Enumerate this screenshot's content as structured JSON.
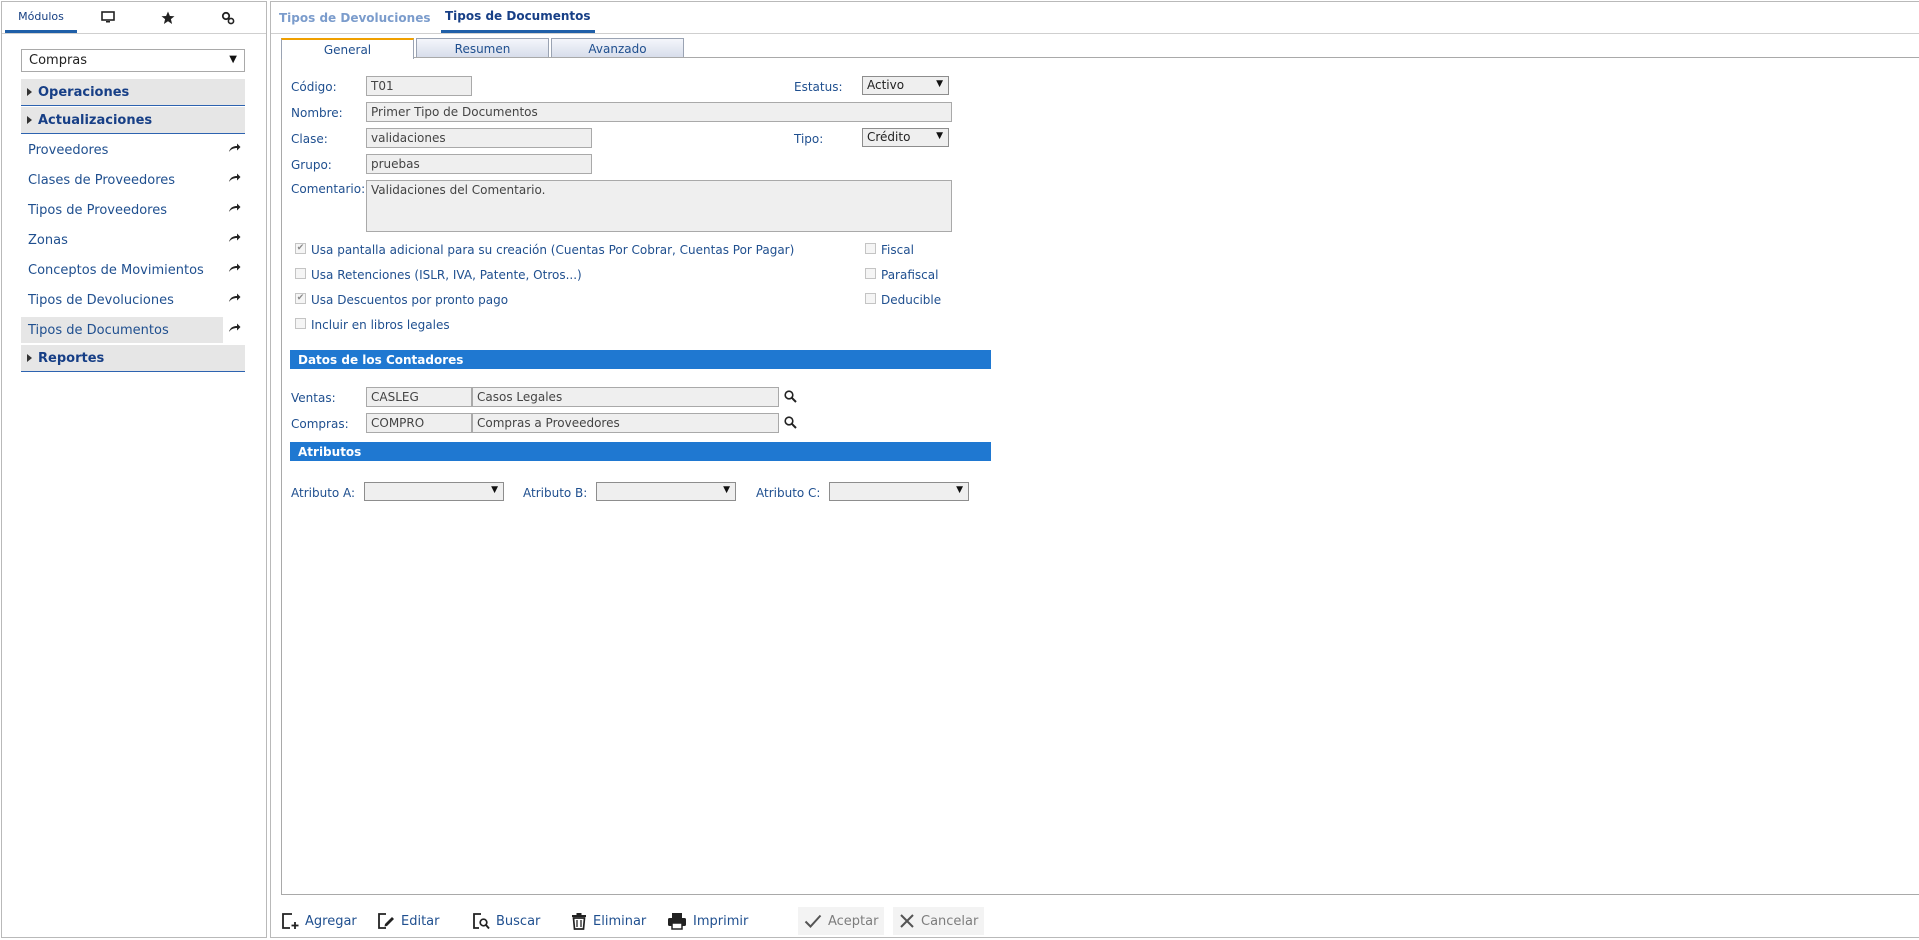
{
  "sidebar": {
    "tabs": [
      {
        "label": "Módulos",
        "icon": ""
      },
      {
        "label": "",
        "icon": "monitor-icon"
      },
      {
        "label": "",
        "icon": "star-icon"
      },
      {
        "label": "",
        "icon": "settings-icon"
      }
    ],
    "module_select": "Compras",
    "groups": {
      "operaciones": "Operaciones",
      "actualizaciones": "Actualizaciones",
      "reportes": "Reportes"
    },
    "items": [
      {
        "label": "Proveedores"
      },
      {
        "label": "Clases de Proveedores"
      },
      {
        "label": "Tipos de Proveedores"
      },
      {
        "label": "Zonas"
      },
      {
        "label": "Conceptos de Movimientos"
      },
      {
        "label": "Tipos de Devoluciones"
      },
      {
        "label": "Tipos de Documentos"
      }
    ]
  },
  "doc_tabs": [
    "Tipos de Devoluciones",
    "Tipos de Documentos"
  ],
  "sub_tabs": [
    "General",
    "Resumen",
    "Avanzado"
  ],
  "form": {
    "codigo": {
      "label": "Código:",
      "value": "T01"
    },
    "estatus": {
      "label": "Estatus:",
      "value": "Activo"
    },
    "nombre": {
      "label": "Nombre:",
      "value": "Primer Tipo de Documentos"
    },
    "clase": {
      "label": "Clase:",
      "value": "validaciones"
    },
    "tipo": {
      "label": "Tipo:",
      "value": "Crédito"
    },
    "grupo": {
      "label": "Grupo:",
      "value": "pruebas"
    },
    "comentario": {
      "label": "Comentario:",
      "value": "Validaciones del Comentario."
    }
  },
  "checks": [
    {
      "label": "Usa pantalla adicional para su creación (Cuentas Por Cobrar, Cuentas Por Pagar)",
      "checked": "✔"
    },
    {
      "label": "Usa Retenciones (ISLR, IVA, Patente, Otros...)",
      "checked": ""
    },
    {
      "label": "Usa Descuentos por pronto pago",
      "checked": "✔"
    },
    {
      "label": "Incluir en libros legales",
      "checked": ""
    },
    {
      "label": "Fiscal",
      "checked": ""
    },
    {
      "label": "Parafiscal",
      "checked": ""
    },
    {
      "label": "Deducible",
      "checked": ""
    }
  ],
  "contadores": {
    "title": "Datos de los Contadores",
    "ventas": {
      "label": "Ventas:",
      "code": "CASLEG",
      "desc": "Casos Legales"
    },
    "compras": {
      "label": "Compras:",
      "code": "COMPRO",
      "desc": "Compras a Proveedores"
    }
  },
  "atributos": {
    "title": "Atributos",
    "a": {
      "label": "Atributo A:",
      "value": ""
    },
    "b": {
      "label": "Atributo B:",
      "value": ""
    },
    "c": {
      "label": "Atributo C:",
      "value": ""
    }
  },
  "actions": {
    "agregar": "Agregar",
    "editar": "Editar",
    "buscar": "Buscar",
    "eliminar": "Eliminar",
    "imprimir": "Imprimir",
    "aceptar": "Aceptar",
    "cancelar": "Cancelar"
  },
  "colors": {
    "accent": "#1f78d1",
    "tab_active": "#f0a000",
    "text": "#1f4f8f"
  }
}
